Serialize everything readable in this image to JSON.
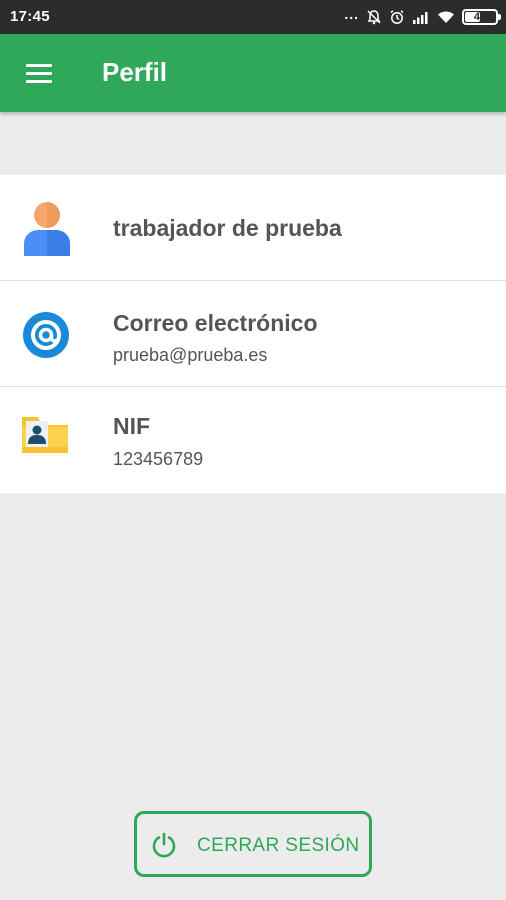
{
  "status_bar": {
    "time": "17:45",
    "battery_level": "48",
    "icons": [
      "more-dots-icon",
      "mute-icon",
      "alarm-icon",
      "signal-icon",
      "wifi-icon",
      "battery-icon"
    ]
  },
  "app_bar": {
    "title": "Perfil",
    "menu_icon": "hamburger-menu-icon"
  },
  "profile": {
    "items": [
      {
        "icon": "user-avatar-icon",
        "title": "trabajador de prueba",
        "subtitle": ""
      },
      {
        "icon": "email-at-icon",
        "title": "Correo electrónico",
        "subtitle": "prueba@prueba.es"
      },
      {
        "icon": "id-folder-icon",
        "title": "NIF",
        "subtitle": "123456789"
      }
    ]
  },
  "logout": {
    "label": "CERRAR SESIÓN",
    "icon": "power-icon"
  },
  "colors": {
    "primary": "#2fa85a",
    "status_bar": "#2c2c2c",
    "background": "#ececec",
    "text": "#555555",
    "avatar_blue": "#4c8ef7",
    "avatar_skin": "#f5a76b",
    "email_blue": "#1a8ad8",
    "folder_yellow": "#f8c235"
  }
}
